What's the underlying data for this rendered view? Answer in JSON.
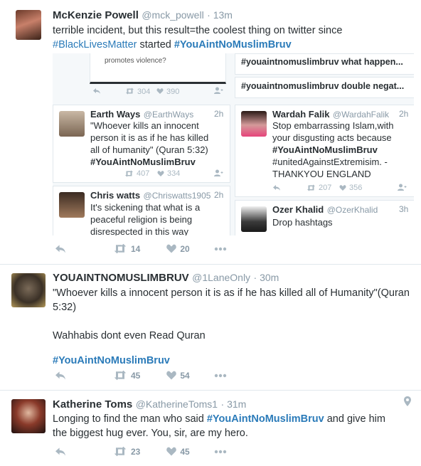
{
  "tweet1": {
    "name": "McKenzie Powell",
    "handle": "@mck_powell",
    "time": "· 13m",
    "text_a": "terrible incident, but this result=the coolest thing on twitter since",
    "tag1": "#BlackLivesMatter",
    "text_b": " started ",
    "tag2": "#YouAintNoMuslimBruv",
    "embed": {
      "top_snippet": "promotes violence?",
      "top_retweets": "304",
      "top_likes": "390",
      "trend1": "#youaintnomuslimbruv what happen...",
      "trend2": "#youaintnomuslimbruv double negat...",
      "earth": {
        "name": "Earth Ways",
        "handle": "@EarthWays",
        "time": "2h",
        "text": "\"Whoever kills an innocent person it is as if he has killed all of humanity\" (Quran 5:32)",
        "tag": "#YouAintNoMuslimBruv",
        "retweets": "407",
        "likes": "334"
      },
      "wardah": {
        "name": "Wardah Falik",
        "handle": "@WardahFalik",
        "time": "2h",
        "text": "Stop embarrassing Islam,with your disgusting acts because",
        "tag": "#YouAintNoMuslimBruv",
        "text2": "#unitedAgainstExtremisim. -THANKYOU ENGLAND",
        "retweets": "207",
        "likes": "356"
      },
      "chris": {
        "name": "Chris watts",
        "handle": "@Chriswatts1905",
        "time": "2h",
        "text": "It's sickening that what is a peaceful religion is being disrespected in this way"
      },
      "ozer": {
        "name": "Ozer Khalid",
        "handle": "@OzerKhalid",
        "time": "3h",
        "text": "Drop hashtags"
      }
    },
    "retweets": "14",
    "likes": "20"
  },
  "tweet2": {
    "name": "YOUAINTNOMUSLIMBRUV",
    "handle": "@1LaneOnly",
    "time": "· 30m",
    "text_a": "\"Whoever kills a innocent person it is as if he has killed all of Humanity\"(Quran 5:32)",
    "text_b": "Wahhabis dont even Read Quran",
    "tag": "#YouAintNoMuslimBruv",
    "retweets": "45",
    "likes": "54"
  },
  "tweet3": {
    "name": "Katherine Toms",
    "handle": "@KatherineToms1",
    "time": "· 31m",
    "text_a": "Longing to find the man who said ",
    "tag": "#YouAintNoMuslimBruv",
    "text_b": " and give him the biggest hug ever. You, sir, are my hero.",
    "retweets": "23",
    "likes": "45"
  },
  "colors": {
    "link": "#2b7bb9",
    "muted": "#8899a6",
    "icon": "#aab8c2",
    "border": "#e1e8ed"
  },
  "icons": [
    "reply-icon",
    "retweet-icon",
    "like-icon",
    "more-icon",
    "follow-icon",
    "location-pin-icon"
  ]
}
